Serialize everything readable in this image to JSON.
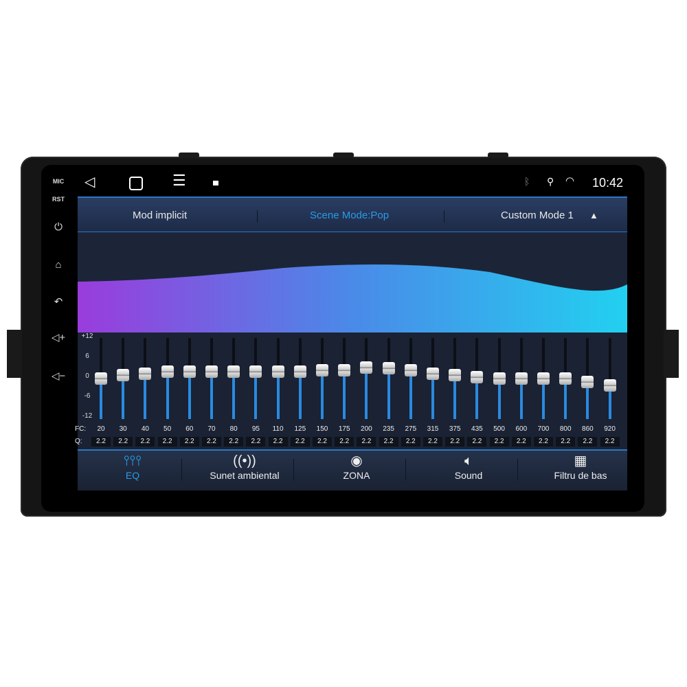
{
  "side_buttons": {
    "mic": "MIC",
    "rst": "RST",
    "power": "power-icon",
    "home": "home-icon",
    "back": "back-icon",
    "vol_up": "volume-up-icon",
    "vol_down": "volume-down-icon"
  },
  "status": {
    "time": "10:42"
  },
  "modes": {
    "left": "Mod implicit",
    "center": "Scene Mode:Pop",
    "right": "Custom Mode 1"
  },
  "colors": {
    "accent": "#2a9ae8",
    "wave_start": "#9a3cdc",
    "wave_end": "#22d0f0"
  },
  "eq": {
    "axis": [
      "+12",
      "6",
      "0",
      "-6",
      "-12"
    ],
    "fc_label": "FC:",
    "q_label": "Q:",
    "range": [
      -12,
      12
    ],
    "bands": [
      {
        "fc": "20",
        "q": "2.2",
        "gain": 0
      },
      {
        "fc": "30",
        "q": "2.2",
        "gain": 1
      },
      {
        "fc": "40",
        "q": "2.2",
        "gain": 1.5
      },
      {
        "fc": "50",
        "q": "2.2",
        "gain": 2
      },
      {
        "fc": "60",
        "q": "2.2",
        "gain": 2
      },
      {
        "fc": "70",
        "q": "2.2",
        "gain": 2
      },
      {
        "fc": "80",
        "q": "2.2",
        "gain": 2
      },
      {
        "fc": "95",
        "q": "2.2",
        "gain": 2
      },
      {
        "fc": "110",
        "q": "2.2",
        "gain": 2
      },
      {
        "fc": "125",
        "q": "2.2",
        "gain": 2
      },
      {
        "fc": "150",
        "q": "2.2",
        "gain": 2.5
      },
      {
        "fc": "175",
        "q": "2.2",
        "gain": 2.5
      },
      {
        "fc": "200",
        "q": "2.2",
        "gain": 3.3
      },
      {
        "fc": "235",
        "q": "2.2",
        "gain": 3
      },
      {
        "fc": "275",
        "q": "2.2",
        "gain": 2.5
      },
      {
        "fc": "315",
        "q": "2.2",
        "gain": 1.5
      },
      {
        "fc": "375",
        "q": "2.2",
        "gain": 1
      },
      {
        "fc": "435",
        "q": "2.2",
        "gain": 0.5
      },
      {
        "fc": "500",
        "q": "2.2",
        "gain": 0
      },
      {
        "fc": "600",
        "q": "2.2",
        "gain": 0
      },
      {
        "fc": "700",
        "q": "2.2",
        "gain": 0
      },
      {
        "fc": "800",
        "q": "2.2",
        "gain": 0
      },
      {
        "fc": "860",
        "q": "2.2",
        "gain": -1
      },
      {
        "fc": "920",
        "q": "2.2",
        "gain": -2
      }
    ]
  },
  "bottom_tabs": [
    {
      "label": "EQ",
      "icon": "equalizer-icon",
      "active": true
    },
    {
      "label": "Sunet ambiental",
      "icon": "surround-icon"
    },
    {
      "label": "ZONA",
      "icon": "target-icon"
    },
    {
      "label": "Sound",
      "icon": "speaker-icon"
    },
    {
      "label": "Filtru de bas",
      "icon": "bass-filter-icon"
    }
  ]
}
